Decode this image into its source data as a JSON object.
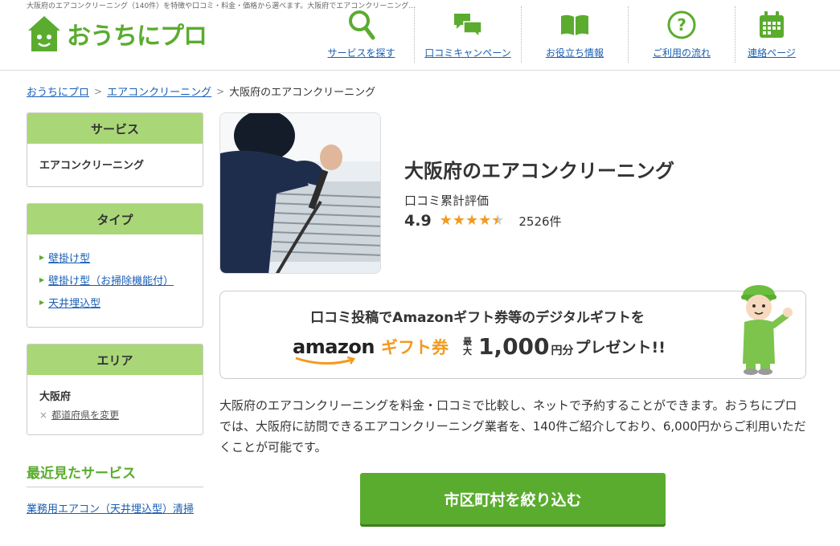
{
  "header": {
    "tagline": "大阪府のエアコンクリーニング（140件）を特徴や口コミ・料金・価格から選べます。大阪府でエアコンクリーニング…",
    "logo_text": "おうちにプロ",
    "nav": [
      {
        "label": "サービスを探す",
        "icon": "search-icon"
      },
      {
        "label": "口コミキャンペーン",
        "icon": "chat-bubbles-icon"
      },
      {
        "label": "お役立ち情報",
        "icon": "book-icon"
      },
      {
        "label": "ご利用の流れ",
        "icon": "question-icon"
      },
      {
        "label": "連絡ページ",
        "icon": "calendar-icon"
      }
    ]
  },
  "breadcrumb": {
    "home": "おうちにプロ",
    "category": "エアコンクリーニング",
    "current": "大阪府のエアコンクリーニング",
    "separator": ">"
  },
  "sidebar": {
    "service": {
      "heading": "サービス",
      "value": "エアコンクリーニング"
    },
    "type": {
      "heading": "タイプ",
      "items": [
        "壁掛け型",
        "壁掛け型（お掃除機能付）",
        "天井埋込型"
      ]
    },
    "area": {
      "heading": "エリア",
      "value": "大阪府",
      "change_mark": "×",
      "change_label": "都道府県を変更"
    },
    "recent": {
      "heading": "最近見たサービス",
      "items": [
        "業務用エアコン（天井埋込型）清掃"
      ]
    }
  },
  "main": {
    "title": "大阪府のエアコンクリーニング",
    "rating_label": "口コミ累計評価",
    "rating_score": "4.9",
    "rating_stars": 4.5,
    "rating_count": "2526件",
    "promo": {
      "line1": "口コミ投稿でAmazonギフト券等のデジタルギフトを",
      "amazon": "amazon",
      "gift": "ギフト券",
      "max_top": "最",
      "max_bottom": "大",
      "amount": "1,000",
      "yen": "円分",
      "present": "プレゼント!!"
    },
    "description": "大阪府のエアコンクリーニングを料金・口コミで比較し、ネットで予約することができます。おうちにプロでは、大阪府に訪問できるエアコンクリーニング業者を、140件ご紹介しており、6,000円からご利用いただくことが可能です。",
    "cta_label": "市区町村を絞り込む"
  },
  "colors": {
    "brand_green": "#5aac2e",
    "header_green": "#a9d777",
    "link_blue": "#1a5fb4",
    "star_orange": "#f39a1e"
  }
}
